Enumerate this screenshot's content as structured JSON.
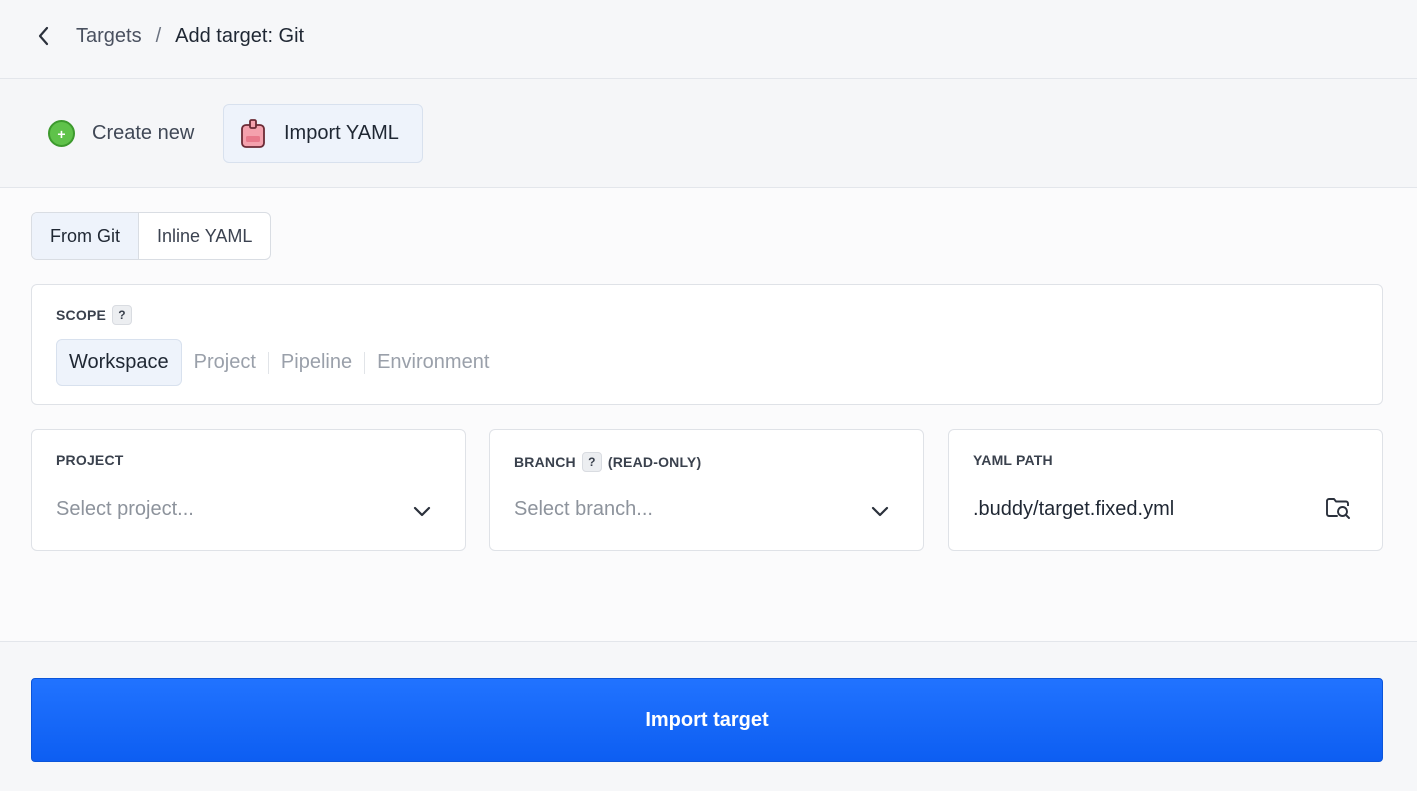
{
  "breadcrumb": {
    "back_icon": "chevron-left-icon",
    "parent": "Targets",
    "separator": "/",
    "current": "Add target: Git"
  },
  "mode_tabs": {
    "create_label": "Create new",
    "create_icon": "plus-circle-icon",
    "import_label": "Import YAML",
    "import_icon": "yaml-file-icon",
    "selected": "Import YAML"
  },
  "source_toggle": {
    "options": [
      "From Git",
      "Inline YAML"
    ],
    "selected": "From Git"
  },
  "scope": {
    "label": "SCOPE",
    "help": "?",
    "options": [
      "Workspace",
      "Project",
      "Pipeline",
      "Environment"
    ],
    "selected": "Workspace"
  },
  "project_field": {
    "label": "PROJECT",
    "placeholder": "Select project..."
  },
  "branch_field": {
    "label": "BRANCH",
    "help": "?",
    "suffix": "(READ-ONLY)",
    "placeholder": "Select branch..."
  },
  "yaml_path_field": {
    "label": "YAML PATH",
    "value": ".buddy/target.fixed.yml",
    "browse_icon": "folder-search-icon"
  },
  "submit": {
    "label": "Import target"
  },
  "colors": {
    "primary": "#1167fb",
    "active_tab_bg": "#eef3fb",
    "create_icon": "#5fc24a",
    "yaml_icon": "#f08a9a"
  }
}
